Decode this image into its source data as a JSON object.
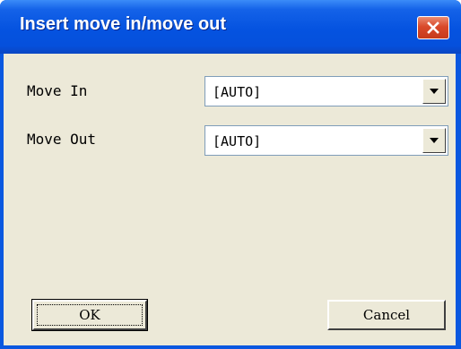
{
  "dialog": {
    "title": "Insert move in/move out",
    "close_icon": "close-x-icon",
    "titlebar_color": "#0553e0",
    "close_color": "#d9492a",
    "client_color": "#ece9d8"
  },
  "fields": [
    {
      "label": "Move In",
      "value": "[AUTO]"
    },
    {
      "label": "Move Out",
      "value": "[AUTO]"
    }
  ],
  "buttons": {
    "ok_label": "OK",
    "cancel_label": "Cancel"
  }
}
